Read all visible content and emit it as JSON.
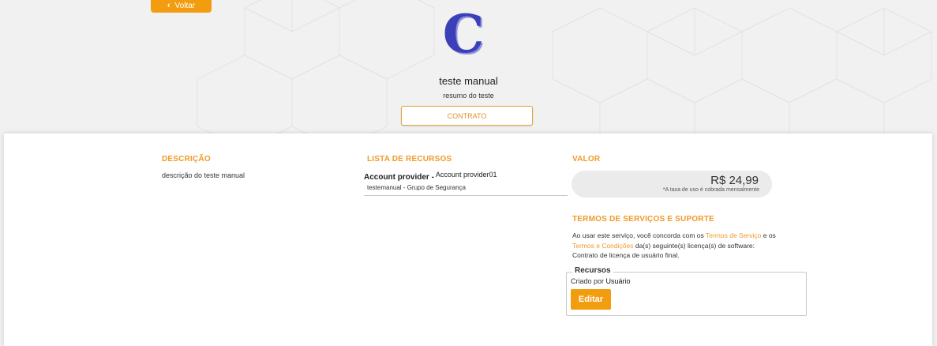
{
  "header": {
    "back_label": "Voltar",
    "title": "teste manual",
    "summary": "resumo do teste",
    "contract_label": "CONTRATO",
    "logo_icon": "c-letter-logo-icon"
  },
  "description": {
    "heading": "DESCRIÇÃO",
    "text": "descrição do teste manual"
  },
  "resources": {
    "heading": "LISTA DE RECURSOS",
    "items": [
      {
        "provider_label": "Account provider -",
        "provider_value": "Account provider01",
        "detail": "testemanual - Grupo de Segurança"
      }
    ]
  },
  "value": {
    "heading": "VALOR",
    "price": "R$ 24,99",
    "note": "*A taxa de uso é cobrada mensalmente"
  },
  "terms": {
    "heading": "TERMOS DE SERVIÇOS E SUPORTE",
    "text_1": "Ao usar este serviço, você concorda com os ",
    "link_1": "Termos de Serviço",
    "text_2": " e os ",
    "link_2": "Termos e Condições",
    "text_3": " da(s) seguinte(s) licença(s) de software: Contrato de licença de usuário final."
  },
  "recursos_box": {
    "legend": "Recursos",
    "created_label": "Criado por",
    "created_value": "Usuário",
    "edit_label": "Editar"
  },
  "colors": {
    "accent": "#f29c10",
    "heading": "#ef9a2a",
    "logo": "#3b3fb8"
  }
}
